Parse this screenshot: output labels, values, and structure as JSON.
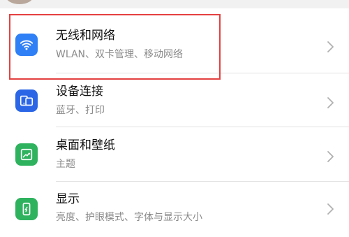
{
  "colors": {
    "wlan_icon": "#2f7ff6",
    "device_icon": "#2a66e6",
    "desktop_icon": "#2fb25e",
    "display_icon": "#2fb25e",
    "highlight": "#e54040",
    "title_text": "#111111",
    "subtitle_text": "#8a8a8a"
  },
  "settings": [
    {
      "id": "wireless-network",
      "icon": "wifi-icon",
      "title": "无线和网络",
      "subtitle": "WLAN、双卡管理、移动网络",
      "highlighted": true
    },
    {
      "id": "device-connection",
      "icon": "device-connection-icon",
      "title": "设备连接",
      "subtitle": "蓝牙、打印"
    },
    {
      "id": "desktop-wallpaper",
      "icon": "wallpaper-icon",
      "title": "桌面和壁纸",
      "subtitle": "主题"
    },
    {
      "id": "display",
      "icon": "display-icon",
      "title": "显示",
      "subtitle": "亮度、护眼模式、字体与显示大小"
    }
  ]
}
